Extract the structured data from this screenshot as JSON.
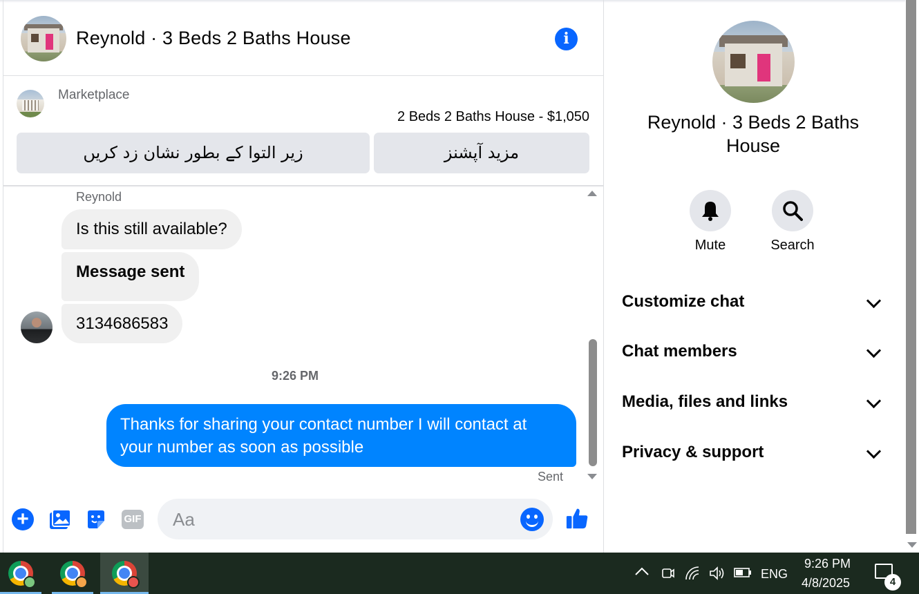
{
  "header": {
    "title": "Reynold · 3 Beds 2 Baths House",
    "info_icon": "info-icon"
  },
  "marketplace": {
    "label": "Marketplace",
    "listing": "2 Beds 2 Baths House - $1,050",
    "mark_pending_label": "زیر التوا کے بطور نشان زد کریں",
    "more_options_label": "مزید آپشنز"
  },
  "messages": {
    "sender_name": "Reynold",
    "incoming": [
      "Is this still available?",
      "Message sent",
      "3134686583"
    ],
    "timestamp": "9:26 PM",
    "outgoing": "Thanks for sharing your contact number I will contact at your number as soon as possible",
    "status": "Sent"
  },
  "composer": {
    "placeholder": "Aa",
    "gif_label": "GIF"
  },
  "right_panel": {
    "title": "Reynold · 3 Beds 2 Baths House",
    "mute_label": "Mute",
    "search_label": "Search",
    "sections": [
      "Customize chat",
      "Chat members",
      "Media, files and links",
      "Privacy & support"
    ]
  },
  "taskbar": {
    "language": "ENG",
    "time": "9:26 PM",
    "date": "4/8/2025",
    "notification_count": "4",
    "colors": {
      "badge1": "#7bc67e",
      "badge2": "#f4a44a",
      "badge3": "#e8544e"
    }
  },
  "colors": {
    "accent": "#0866ff",
    "outgoing_bubble": "#0084ff",
    "incoming_bubble": "#f0f0f0"
  }
}
